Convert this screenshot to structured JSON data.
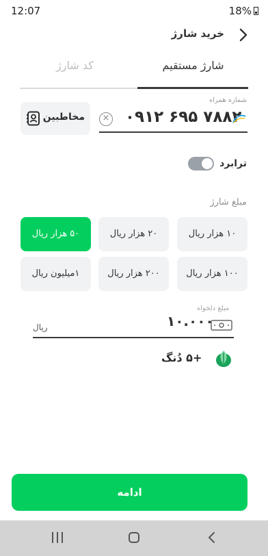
{
  "status_bar": {
    "time": "12:07",
    "battery": "18%"
  },
  "header": {
    "title": "خرید شارژ",
    "back_icon": "chevron-right-icon"
  },
  "tabs": [
    {
      "label": "شارژ مستقیم",
      "active": true
    },
    {
      "label": "کد شارژ",
      "active": false
    }
  ],
  "phone": {
    "label": "شماره همراه",
    "value": "۰۹۱۲ ۶۹۵ ۷۸۸۲",
    "clear_icon": "close-circle-icon",
    "operator_icon": "mci-operator-icon"
  },
  "contacts": {
    "label": "مخاطبین",
    "icon": "contacts-book-icon"
  },
  "transfer": {
    "label": "ترابرد",
    "enabled": false
  },
  "amounts": {
    "title": "مبلغ شارژ",
    "items": [
      {
        "label": "۱۰ هزار ریال",
        "selected": false
      },
      {
        "label": "۲۰ هزار ریال",
        "selected": false
      },
      {
        "label": "۵۰ هزار ریال",
        "selected": true
      },
      {
        "label": "۱۰۰ هزار ریال",
        "selected": false
      },
      {
        "label": "۲۰۰ هزار ریال",
        "selected": false
      },
      {
        "label": "۱میلیون ریال",
        "selected": false
      }
    ]
  },
  "custom_amount": {
    "label": "مبلغ دلخواه",
    "value": "۱۰.۰۰۰",
    "currency": "ریال",
    "icon": "money-bill-icon"
  },
  "reward": {
    "text": "+۵ دُنگ",
    "icon": "dong-leaf-icon"
  },
  "continue_button": {
    "label": "ادامه"
  },
  "navbar": {
    "recents_icon": "recents-icon",
    "home_icon": "home-icon",
    "back_icon": "back-icon"
  },
  "colors": {
    "accent": "#04cf5e",
    "text": "#2e2e2e",
    "muted": "#9a9a9a",
    "chip_bg": "#f1f2f4"
  }
}
